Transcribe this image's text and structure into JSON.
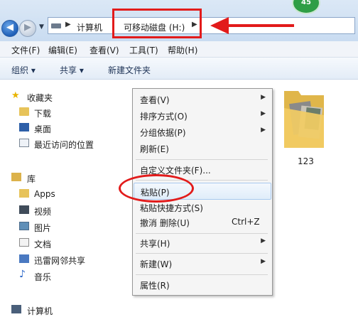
{
  "badge": {
    "value": "45"
  },
  "address": {
    "crumbs": [
      "计算机",
      "可移动磁盘 (H:)"
    ]
  },
  "menubar": {
    "items": [
      "文件(F)",
      "编辑(E)",
      "查看(V)",
      "工具(T)",
      "帮助(H)"
    ]
  },
  "toolbar": {
    "organize": "组织 ▾",
    "share": "共享 ▾",
    "new_folder": "新建文件夹"
  },
  "navpane": {
    "favorites": "收藏夹",
    "downloads": "下载",
    "desktop": "桌面",
    "recent": "最近访问的位置",
    "library": "库",
    "apps": "Apps",
    "videos": "视频",
    "pictures": "图片",
    "documents": "文档",
    "xunlei": "迅雷网邻共享",
    "music": "音乐",
    "computer": "计算机"
  },
  "content": {
    "folder_name": "123"
  },
  "context_menu": {
    "view": "查看(V)",
    "sort": "排序方式(O)",
    "group": "分组依据(P)",
    "refresh": "刷新(E)",
    "customize": "自定义文件夹(F)...",
    "paste": "粘贴(P)",
    "paste_shortcut": "粘贴快捷方式(S)",
    "undo": "撤消 删除(U)",
    "undo_shortcut": "Ctrl+Z",
    "share": "共享(H)",
    "new": "新建(W)",
    "properties": "属性(R)"
  },
  "colors": {
    "annotation_red": "#e21b1b",
    "badge_green": "#2f9e45"
  }
}
